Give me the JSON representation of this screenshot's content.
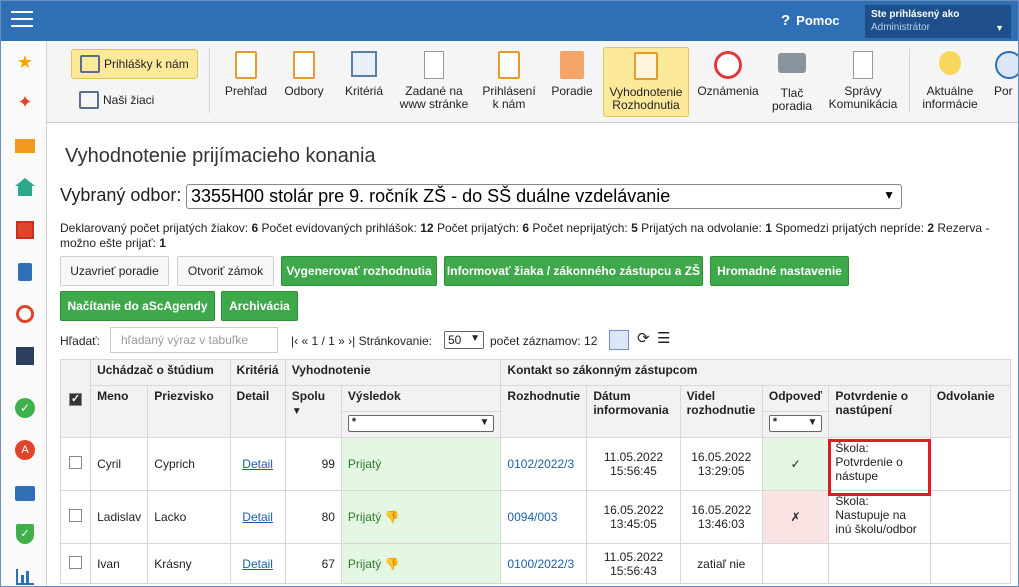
{
  "topbar": {
    "help_label": "Pomoc",
    "user_line1": "Ste prihlásený ako",
    "user_line2": "Administrátor"
  },
  "sidebar": {
    "icons": [
      "star-icon",
      "magic-wand-icon",
      "mail-icon",
      "home-icon",
      "calendar-icon",
      "book-icon",
      "user-icon",
      "timetable-icon",
      "checkmark-icon",
      "alert-icon",
      "briefcase-icon",
      "shield-icon",
      "chart-icon"
    ]
  },
  "toolbar": {
    "left": [
      {
        "label": "Prihlášky k nám",
        "active": true
      },
      {
        "label": "Naši žiaci",
        "active": false
      }
    ],
    "items": [
      {
        "label": "Prehľad"
      },
      {
        "label": "Odbory"
      },
      {
        "label": "Kritériá"
      },
      {
        "label": "Zadané na www stránke"
      },
      {
        "label": "Prihlásení k nám"
      },
      {
        "label": "Poradie"
      },
      {
        "label": "Vyhodnotenie Rozhodnutia",
        "active": true
      },
      {
        "label": "Oznámenia"
      },
      {
        "label": "Tlač poradia"
      },
      {
        "label": "Správy Komunikácia"
      },
      {
        "label": "Aktuálne informácie"
      },
      {
        "label": "Por"
      }
    ]
  },
  "page": {
    "title": "Vyhodnotenie prijímacieho konania",
    "odbor_label": "Vybraný odbor:",
    "odbor_value": "3355H00 stolár pre 9. ročník ZŠ - do SŠ duálne vzdelávanie"
  },
  "stats": {
    "l1": "Deklarovaný počet prijatých žiakov:",
    "v1": "6",
    "l2": "Počet evidovaných prihlášok:",
    "v2": "12",
    "l3": "Počet prijatých:",
    "v3": "6",
    "l4": "Počet neprijatých:",
    "v4": "5",
    "l5": "Prijatých na odvolanie:",
    "v5": "1",
    "l6": "Spomedzi prijatých nepríde:",
    "v6": "2",
    "l7": "Rezerva - možno ešte prijať:",
    "v7": "1"
  },
  "buttons": {
    "close_order": "Uzavrieť poradie",
    "open_lock": "Otvoriť zámok",
    "generate": "Vygenerovať rozhodnutia",
    "inform": "Informovať žiaka / zákonného zástupcu a ZŠ",
    "bulk": "Hromadné nastavenie",
    "load_asc": "Načítanie do aScAgendy",
    "archive": "Archivácia"
  },
  "filter": {
    "search_label": "Hľadať:",
    "search_placeholder": "hľadaný výraz v tabuľke",
    "pager": "|‹ « 1 / 1 » ›|",
    "paging_label": "Stránkovanie:",
    "paging_value": "50",
    "count_text": "počet záznamov: 12"
  },
  "table": {
    "groups": {
      "applicant": "Uchádzač o štúdium",
      "criteria": "Kritériá",
      "evaluation": "Vyhodnotenie",
      "contact": "Kontakt so zákonným zástupcom"
    },
    "headers": {
      "first_name": "Meno",
      "last_name": "Priezvisko",
      "detail": "Detail",
      "total": "Spolu",
      "result": "Výsledok",
      "decision": "Rozhodnutie",
      "date_informed": "Dátum informovania",
      "seen": "Videl rozhodnutie",
      "response": "Odpoveď",
      "confirmation": "Potvrdenie o nastúpení",
      "appeal": "Odvolanie"
    },
    "filters": {
      "result": "*",
      "response": "*"
    },
    "rows": [
      {
        "first_name": "Cyril",
        "last_name": "Cyprich",
        "detail": "Detail",
        "total": "99",
        "result": "Prijatý",
        "decision": "0102/2022/3",
        "date_informed": "11.05.2022 15:56:45",
        "seen": "16.05.2022 13:29:05",
        "response": "✓",
        "confirmation": "Škola: Potvrdenie o nástupe",
        "appeal": ""
      },
      {
        "first_name": "Ladislav",
        "last_name": "Lacko",
        "detail": "Detail",
        "total": "80",
        "result": "Prijatý",
        "decision": "0094/003",
        "date_informed": "16.05.2022 13:45:05",
        "seen": "16.05.2022 13:46:03",
        "response": "✗",
        "confirmation": "Škola: Nastupuje na inú školu/odbor",
        "appeal": ""
      },
      {
        "first_name": "Ivan",
        "last_name": "Krásny",
        "detail": "Detail",
        "total": "67",
        "result": "Prijatý",
        "decision": "0100/2022/3",
        "date_informed": "11.05.2022 15:56:43",
        "seen": "zatiaľ nie",
        "response": "",
        "confirmation": "",
        "appeal": ""
      }
    ]
  }
}
